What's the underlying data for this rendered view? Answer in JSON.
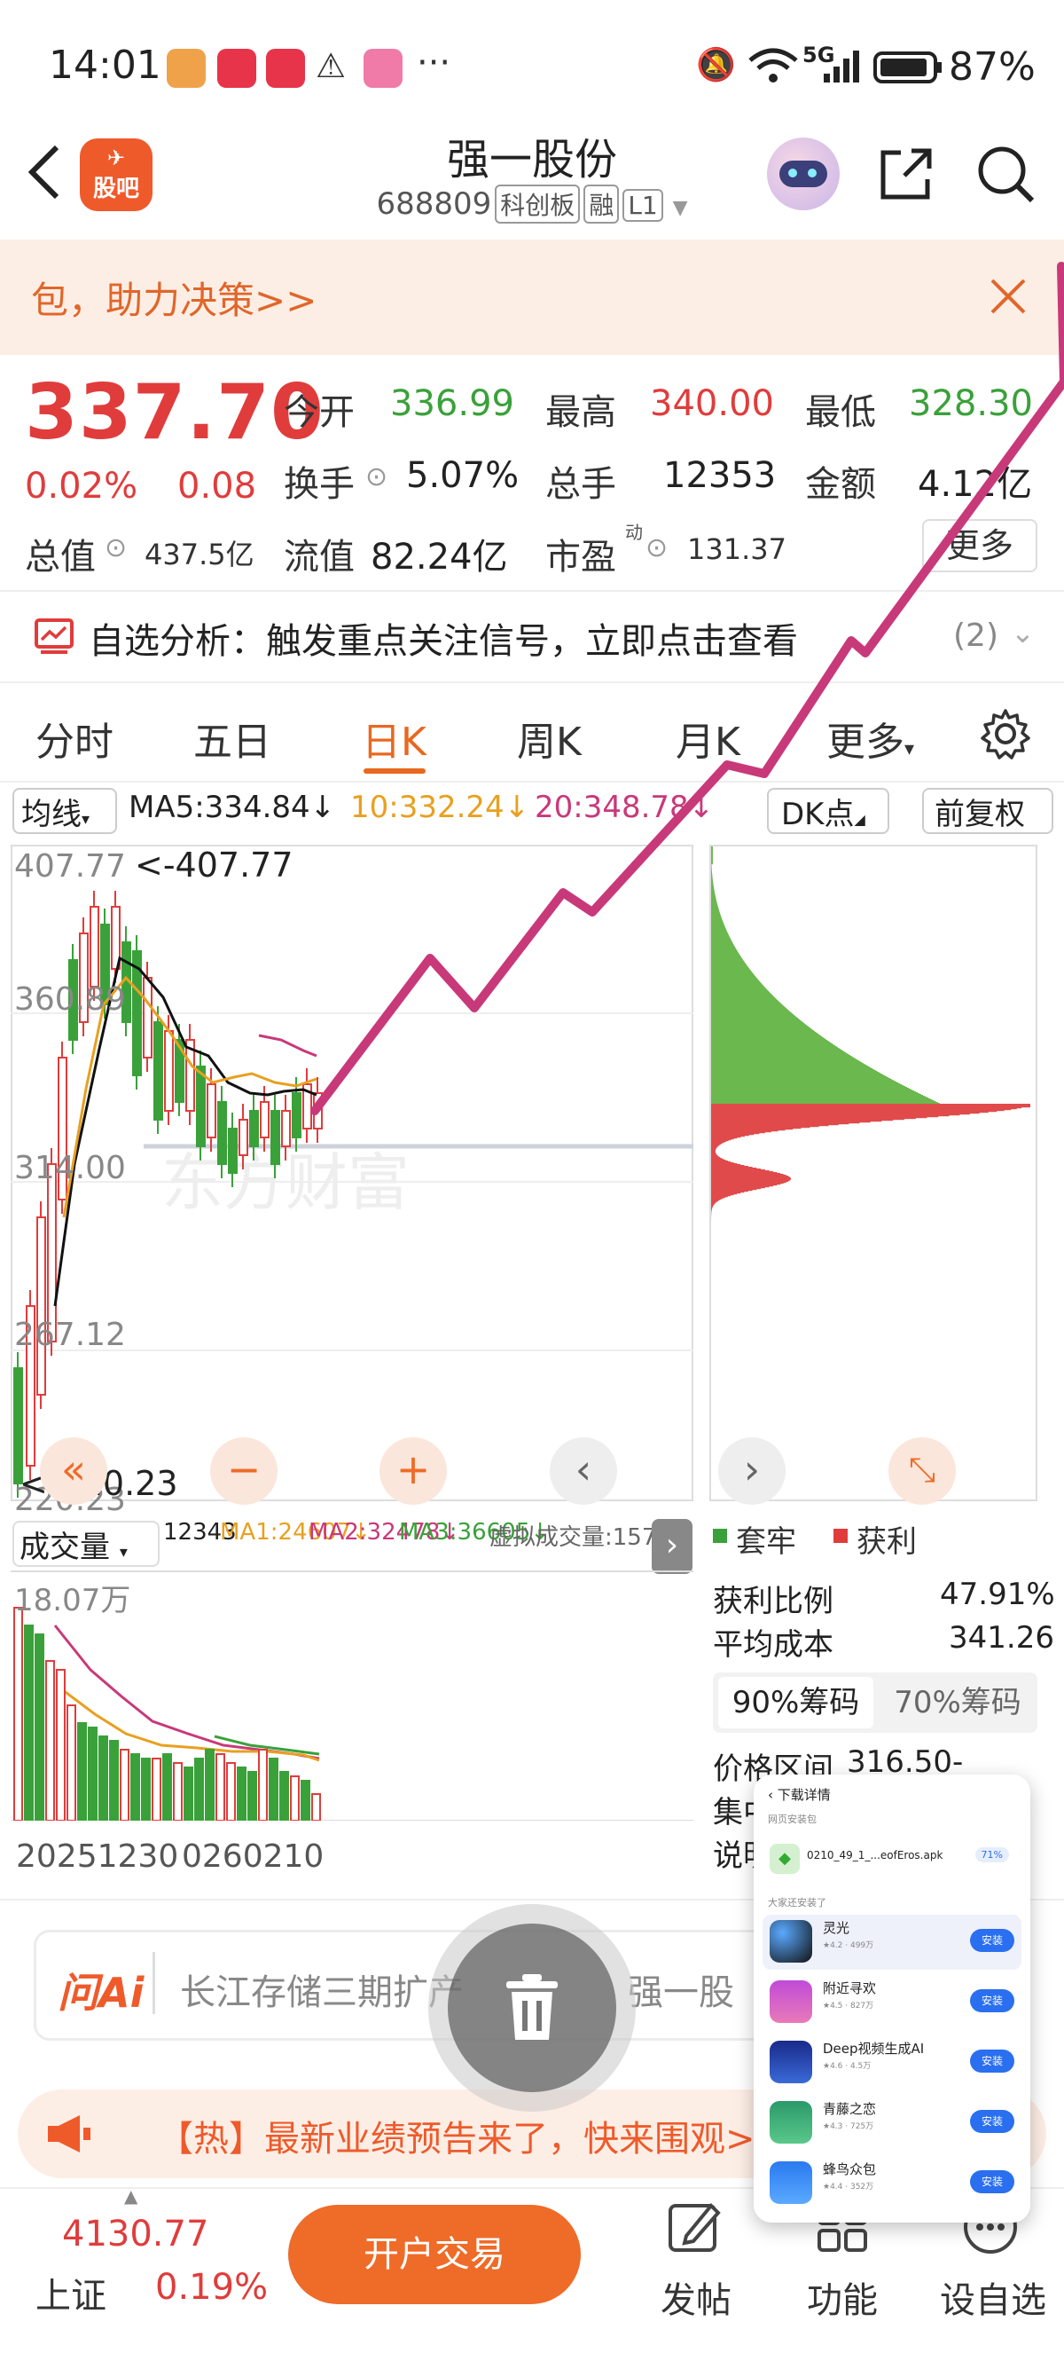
{
  "status": {
    "time": "14:01",
    "dots": "···",
    "network": "5G",
    "battery": "87%"
  },
  "header": {
    "back_icon": "chevron-left-icon",
    "app_logo_text": "股吧",
    "title": "强一股份",
    "code": "688809",
    "board": "科创板",
    "margin": "融",
    "level": "L1"
  },
  "banner": {
    "text": "包，助力决策>>"
  },
  "quote": {
    "price": "337.70",
    "change_pct": "0.02%",
    "change_abs": "0.08",
    "open_label": "今开",
    "open": "336.99",
    "high_label": "最高",
    "high": "340.00",
    "low_label": "最低",
    "low": "328.30",
    "turnover_label": "换手",
    "turnover": "5.07%",
    "volume_label": "总手",
    "volume": "12353",
    "amount_label": "金额",
    "amount": "4.12亿",
    "mktcap_label": "总值",
    "mktcap": "437.5亿",
    "float_label": "流值",
    "float": "82.24亿",
    "pe_label": "市盈",
    "pe_sup": "动",
    "pe": "131.37",
    "more": "更多"
  },
  "signal": {
    "text": "自选分析：触发重点关注信号，立即点击查看",
    "count": "(2)"
  },
  "tabs": [
    "分时",
    "五日",
    "日K",
    "周K",
    "月K",
    "更多"
  ],
  "active_tab": "日K",
  "ma": {
    "selector": "均线",
    "ma5": "MA5:334.84",
    "ma10": "10:332.24",
    "ma20": "20:348.78",
    "dk": "DK点",
    "adjust": "前复权"
  },
  "kline": {
    "y_labels": [
      "407.77",
      "360.89",
      "314.00",
      "267.12",
      "220.23"
    ],
    "max_note": "<-407.77",
    "min_note": "<-220.23",
    "watermark": "东方财富"
  },
  "volume": {
    "selector": "成交量",
    "v": "12343",
    "ma1": "MA1:24607",
    "ma2": "MA2:32478",
    "ma3": "MA3:36605",
    "virtual": "虚拟成交量:15713",
    "max": "18.07万",
    "date_left": "20251230",
    "date_right": "0260210"
  },
  "chips": {
    "legend_trap": "套牢",
    "legend_profit": "获利",
    "profit_ratio_label": "获利比例",
    "profit_ratio": "47.91%",
    "avg_cost_label": "平均成本",
    "avg_cost": "341.26",
    "tab90": "90%筹码",
    "tab70": "70%筹码",
    "range_label": "价格区间",
    "range": "316.50-375.26",
    "conc_label": "集中",
    "desc_label": "说明"
  },
  "ai": {
    "logo": "问Ai",
    "placeholder": "长江存储三期扩产",
    "tail": "强一股"
  },
  "hot": {
    "text": "【热】最新业绩预告来了，快来围观>"
  },
  "bottom": {
    "index_value": "4130.77",
    "index_name": "上证",
    "index_change": "0.19%",
    "trade": "开户交易",
    "post": "发帖",
    "func": "功能",
    "watch": "设自选"
  },
  "popup": {
    "title": "下载详情",
    "section1": "网页安装包",
    "file": "0210_49_1_...eofEros.apk",
    "file_pct": "71%",
    "section2": "大家还安装了",
    "apps": [
      {
        "name": "灵光",
        "desc": "★4.2 · 499万",
        "btn": "安装"
      },
      {
        "name": "附近寻欢",
        "desc": "★4.5 · 827万",
        "btn": "安装"
      },
      {
        "name": "Deep视频生成AI",
        "desc": "★4.6 · 4.5万",
        "btn": "安装"
      },
      {
        "name": "青藤之恋",
        "desc": "★4.3 · 725万",
        "btn": "安装"
      },
      {
        "name": "蜂鸟众包",
        "desc": "★4.4 · 352万",
        "btn": "安装"
      }
    ]
  },
  "colors": {
    "red": "#e03c3c",
    "green": "#3aa13a",
    "orange": "#e8681f",
    "magenta": "#c8397a"
  }
}
